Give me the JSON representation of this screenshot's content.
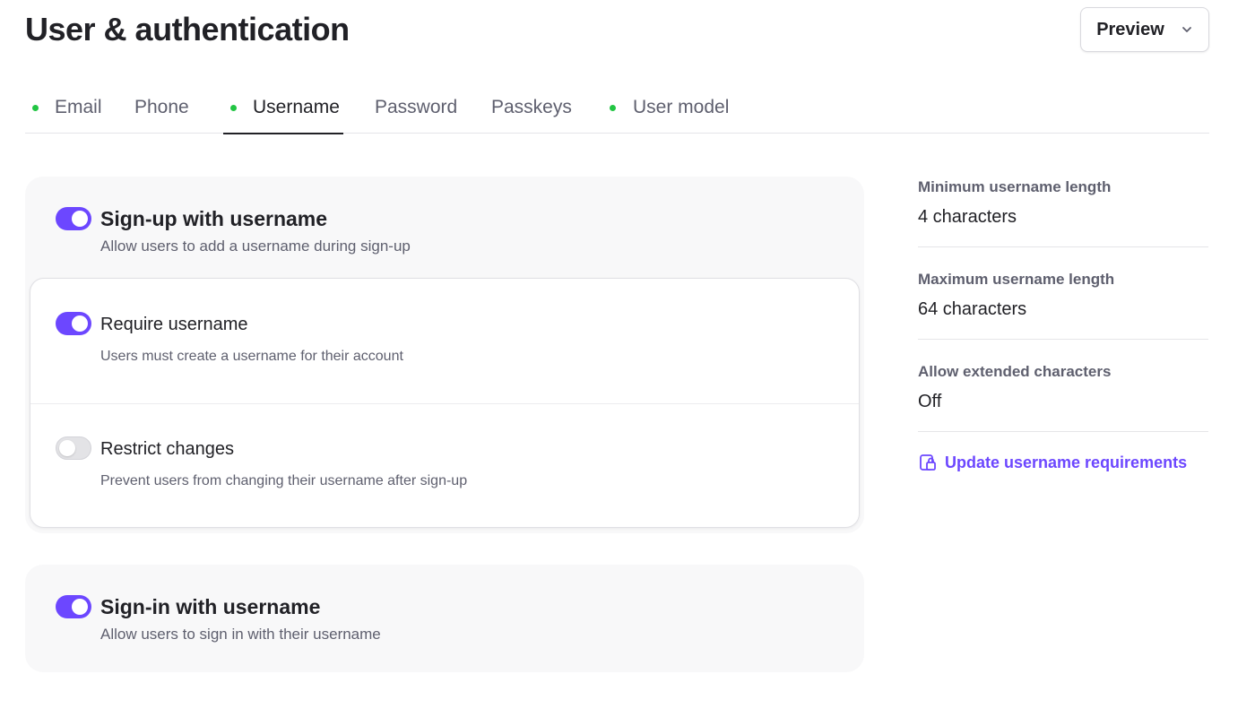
{
  "header": {
    "title": "User & authentication",
    "preview_label": "Preview"
  },
  "tabs": [
    {
      "label": "Email",
      "dot": true,
      "active": false
    },
    {
      "label": "Phone",
      "dot": false,
      "active": false
    },
    {
      "label": "Username",
      "dot": true,
      "active": true
    },
    {
      "label": "Password",
      "dot": false,
      "active": false
    },
    {
      "label": "Passkeys",
      "dot": false,
      "active": false
    },
    {
      "label": "User model",
      "dot": true,
      "active": false
    }
  ],
  "signup": {
    "title": "Sign-up with username",
    "description": "Allow users to add a username during sign-up",
    "enabled": true,
    "options": [
      {
        "title": "Require username",
        "description": "Users must create a username for their account",
        "enabled": true
      },
      {
        "title": "Restrict changes",
        "description": "Prevent users from changing their username after sign-up",
        "enabled": false
      }
    ]
  },
  "signin": {
    "title": "Sign-in with username",
    "description": "Allow users to sign in with their username",
    "enabled": true
  },
  "sidebar": {
    "settings": [
      {
        "label": "Minimum username length",
        "value": "4 characters"
      },
      {
        "label": "Maximum username length",
        "value": "64 characters"
      },
      {
        "label": "Allow extended characters",
        "value": "Off"
      }
    ],
    "link_label": "Update username requirements"
  },
  "colors": {
    "accent": "#6c47ff",
    "status_dot": "#22c543"
  }
}
